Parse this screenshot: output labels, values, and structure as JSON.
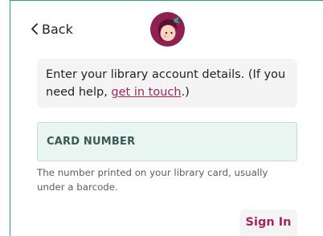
{
  "header": {
    "back_label": "Back",
    "logo_icon": "libby-logo"
  },
  "instructions": {
    "text_before": "Enter your library account details. (If you need help, ",
    "link_text": "get in touch",
    "text_after": ".)"
  },
  "card_field": {
    "placeholder": "CARD NUMBER",
    "value": ""
  },
  "help_text": "The number printed on your library card, usually under a barcode.",
  "actions": {
    "sign_in_label": "Sign In"
  },
  "colors": {
    "accent": "#a3275c",
    "frame": "#2f9e83",
    "field_bg": "#e9f5f1"
  }
}
